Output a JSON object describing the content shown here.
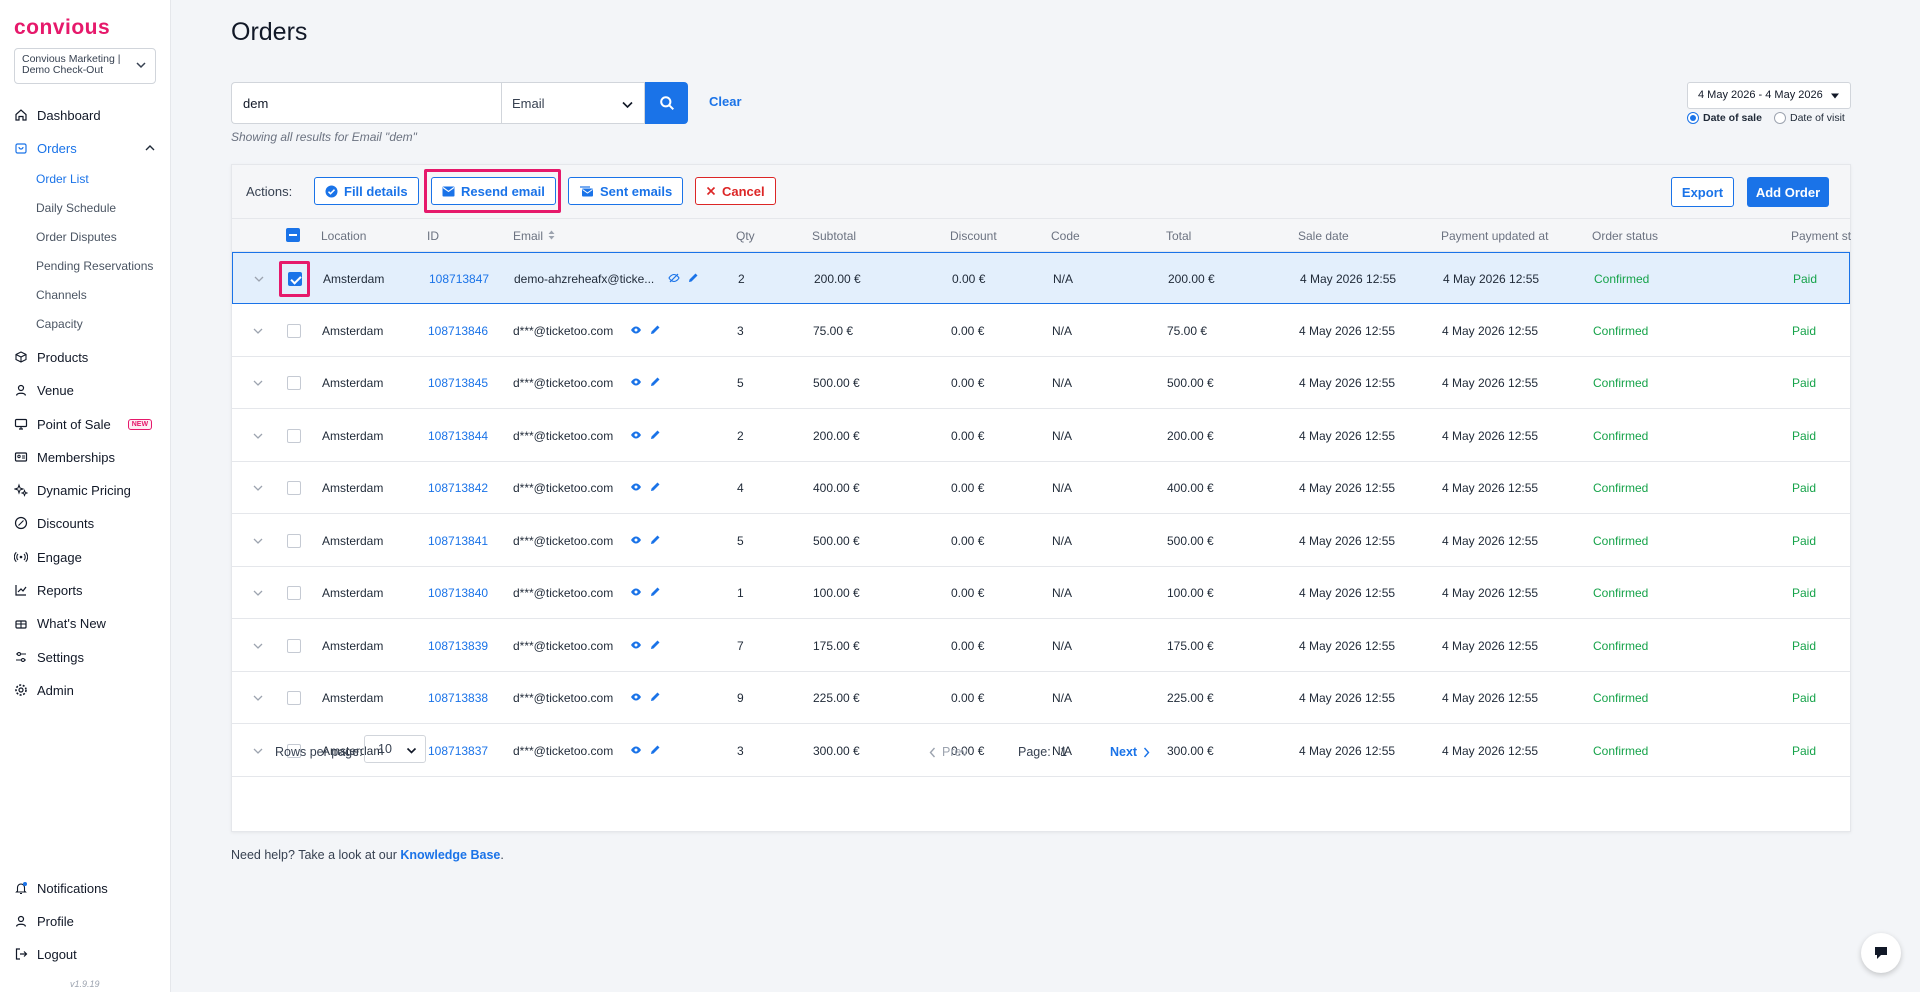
{
  "app": {
    "logo": "convious",
    "account": "Convious Marketing | Demo Check-Out",
    "version": "v1.9.19"
  },
  "sidebar": {
    "items": [
      {
        "label": "Dashboard",
        "icon": "home-icon"
      },
      {
        "label": "Orders",
        "icon": "bag-icon",
        "active": true
      },
      {
        "label": "Products",
        "icon": "box-icon"
      },
      {
        "label": "Venue",
        "icon": "user-icon"
      },
      {
        "label": "Point of Sale",
        "icon": "monitor-icon",
        "badge": "NEW"
      },
      {
        "label": "Memberships",
        "icon": "id-card-icon"
      },
      {
        "label": "Dynamic Pricing",
        "icon": "sparkle-icon"
      },
      {
        "label": "Discounts",
        "icon": "percent-icon"
      },
      {
        "label": "Engage",
        "icon": "broadcast-icon"
      },
      {
        "label": "Reports",
        "icon": "chart-icon"
      },
      {
        "label": "What's New",
        "icon": "gift-icon"
      },
      {
        "label": "Settings",
        "icon": "sliders-icon"
      },
      {
        "label": "Admin",
        "icon": "gear-icon"
      }
    ],
    "sub_items": [
      "Order List",
      "Daily Schedule",
      "Order Disputes",
      "Pending Reservations",
      "Channels",
      "Capacity"
    ],
    "bottom": [
      "Notifications",
      "Profile",
      "Logout"
    ]
  },
  "page": {
    "title": "Orders"
  },
  "search": {
    "value": "dem",
    "field": "Email",
    "clear": "Clear",
    "hint": "Showing all results for Email \"dem\""
  },
  "date_filter": {
    "range": "4 May 2026 - 4 May 2026",
    "option_sale": "Date of sale",
    "option_visit": "Date of visit",
    "selected": "Date of sale"
  },
  "actions": {
    "label": "Actions:",
    "fill": "Fill details",
    "resend": "Resend email",
    "sent": "Sent emails",
    "cancel": "Cancel",
    "export": "Export",
    "add": "Add Order"
  },
  "table": {
    "headers": [
      "Location",
      "ID",
      "Email",
      "Qty",
      "Subtotal",
      "Discount",
      "Code",
      "Total",
      "Sale date",
      "Payment updated at",
      "Order status",
      "Payment st"
    ],
    "rows": [
      {
        "location": "Amsterdam",
        "id": "108713847",
        "email": "demo-ahzreheafx@ticke...",
        "qty": "2",
        "subtotal": "200.00 €",
        "discount": "0.00 €",
        "code": "N/A",
        "total": "200.00 €",
        "sale_date": "4 May 2026 12:55",
        "payment_updated": "4 May 2026 12:55",
        "status": "Confirmed",
        "payment": "Paid",
        "selected": true
      },
      {
        "location": "Amsterdam",
        "id": "108713846",
        "email": "d***@ticketoo.com",
        "qty": "3",
        "subtotal": "75.00 €",
        "discount": "0.00 €",
        "code": "N/A",
        "total": "75.00 €",
        "sale_date": "4 May 2026 12:55",
        "payment_updated": "4 May 2026 12:55",
        "status": "Confirmed",
        "payment": "Paid"
      },
      {
        "location": "Amsterdam",
        "id": "108713845",
        "email": "d***@ticketoo.com",
        "qty": "5",
        "subtotal": "500.00 €",
        "discount": "0.00 €",
        "code": "N/A",
        "total": "500.00 €",
        "sale_date": "4 May 2026 12:55",
        "payment_updated": "4 May 2026 12:55",
        "status": "Confirmed",
        "payment": "Paid"
      },
      {
        "location": "Amsterdam",
        "id": "108713844",
        "email": "d***@ticketoo.com",
        "qty": "2",
        "subtotal": "200.00 €",
        "discount": "0.00 €",
        "code": "N/A",
        "total": "200.00 €",
        "sale_date": "4 May 2026 12:55",
        "payment_updated": "4 May 2026 12:55",
        "status": "Confirmed",
        "payment": "Paid"
      },
      {
        "location": "Amsterdam",
        "id": "108713842",
        "email": "d***@ticketoo.com",
        "qty": "4",
        "subtotal": "400.00 €",
        "discount": "0.00 €",
        "code": "N/A",
        "total": "400.00 €",
        "sale_date": "4 May 2026 12:55",
        "payment_updated": "4 May 2026 12:55",
        "status": "Confirmed",
        "payment": "Paid"
      },
      {
        "location": "Amsterdam",
        "id": "108713841",
        "email": "d***@ticketoo.com",
        "qty": "5",
        "subtotal": "500.00 €",
        "discount": "0.00 €",
        "code": "N/A",
        "total": "500.00 €",
        "sale_date": "4 May 2026 12:55",
        "payment_updated": "4 May 2026 12:55",
        "status": "Confirmed",
        "payment": "Paid"
      },
      {
        "location": "Amsterdam",
        "id": "108713840",
        "email": "d***@ticketoo.com",
        "qty": "1",
        "subtotal": "100.00 €",
        "discount": "0.00 €",
        "code": "N/A",
        "total": "100.00 €",
        "sale_date": "4 May 2026 12:55",
        "payment_updated": "4 May 2026 12:55",
        "status": "Confirmed",
        "payment": "Paid"
      },
      {
        "location": "Amsterdam",
        "id": "108713839",
        "email": "d***@ticketoo.com",
        "qty": "7",
        "subtotal": "175.00 €",
        "discount": "0.00 €",
        "code": "N/A",
        "total": "175.00 €",
        "sale_date": "4 May 2026 12:55",
        "payment_updated": "4 May 2026 12:55",
        "status": "Confirmed",
        "payment": "Paid"
      },
      {
        "location": "Amsterdam",
        "id": "108713838",
        "email": "d***@ticketoo.com",
        "qty": "9",
        "subtotal": "225.00 €",
        "discount": "0.00 €",
        "code": "N/A",
        "total": "225.00 €",
        "sale_date": "4 May 2026 12:55",
        "payment_updated": "4 May 2026 12:55",
        "status": "Confirmed",
        "payment": "Paid"
      },
      {
        "location": "Amsterdam",
        "id": "108713837",
        "email": "d***@ticketoo.com",
        "qty": "3",
        "subtotal": "300.00 €",
        "discount": "0.00 €",
        "code": "N/A",
        "total": "300.00 €",
        "sale_date": "4 May 2026 12:55",
        "payment_updated": "4 May 2026 12:55",
        "status": "Confirmed",
        "payment": "Paid"
      }
    ]
  },
  "pagination": {
    "rows_label": "Rows per page:",
    "rows_value": "10",
    "prev": "Prev",
    "page_label": "Page:",
    "page": "1",
    "next": "Next"
  },
  "help": {
    "text": "Need help? Take a look at our ",
    "link": "Knowledge Base",
    "end": "."
  },
  "colors": {
    "accent": "#1a73e8",
    "brand": "#e6196b",
    "success": "#16a34a",
    "danger": "#dc2626"
  }
}
